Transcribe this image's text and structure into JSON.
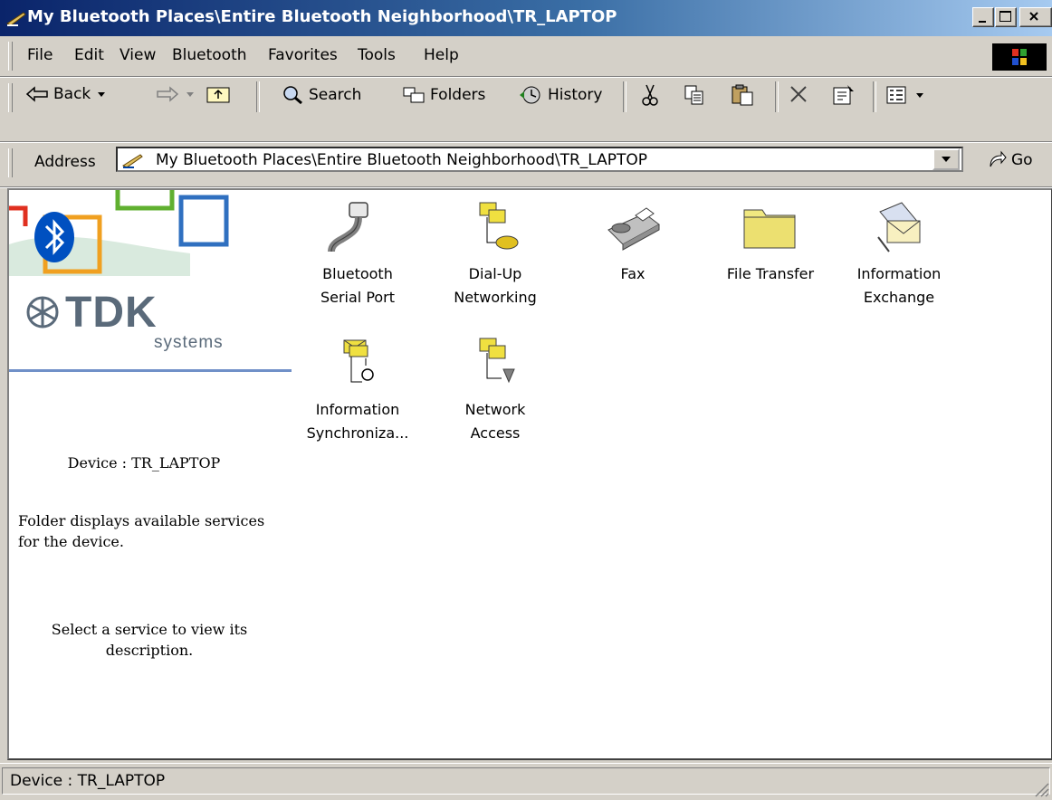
{
  "window": {
    "title": "My Bluetooth Places\\Entire Bluetooth Neighborhood\\TR_LAPTOP"
  },
  "menu": {
    "items": [
      "File",
      "Edit",
      "View",
      "Bluetooth",
      "Favorites",
      "Tools",
      "Help"
    ]
  },
  "toolbar": {
    "back_label": "Back",
    "search_label": "Search",
    "folders_label": "Folders",
    "history_label": "History"
  },
  "address": {
    "label": "Address",
    "value": "My Bluetooth Places\\Entire Bluetooth Neighborhood\\TR_LAPTOP",
    "go_label": "Go"
  },
  "sidebar": {
    "brand": "TDK",
    "brand_sub": "systems",
    "device": "Device : TR_LAPTOP",
    "folder_note": "Folder displays available services for the device.",
    "select_note": "Select a service to view its description."
  },
  "services": [
    {
      "line1": "Bluetooth",
      "line2": "Serial Port",
      "icon": "serial-port-icon"
    },
    {
      "line1": "Dial-Up",
      "line2": "Networking",
      "icon": "dialup-icon"
    },
    {
      "line1": "Fax",
      "line2": "",
      "icon": "fax-icon"
    },
    {
      "line1": "File Transfer",
      "line2": "",
      "icon": "folder-icon"
    },
    {
      "line1": "Information",
      "line2": "Exchange",
      "icon": "envelope-icon"
    },
    {
      "line1": "Information",
      "line2": "Synchroniza...",
      "icon": "sync-icon"
    },
    {
      "line1": "Network",
      "line2": "Access",
      "icon": "network-icon"
    }
  ],
  "status": {
    "text": "Device : TR_LAPTOP"
  }
}
